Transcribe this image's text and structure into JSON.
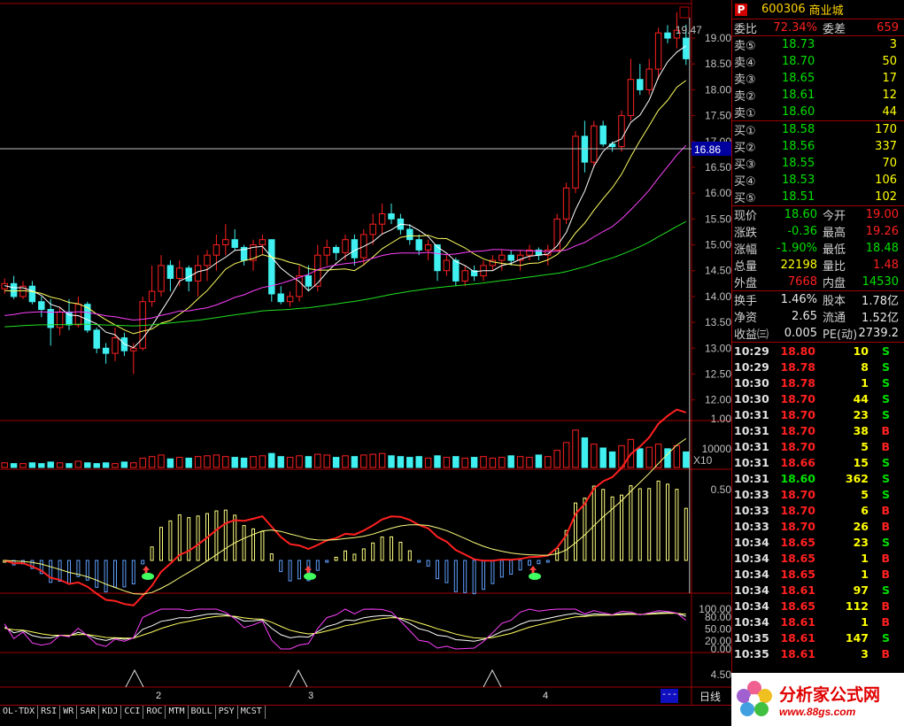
{
  "stock": {
    "badge": "P",
    "code": "600306",
    "name": "商业城"
  },
  "ratio": {
    "wei_bi_label": "委比",
    "wei_bi": "72.34%",
    "wei_cha_label": "委差",
    "wei_cha": "659"
  },
  "asks": [
    {
      "label": "卖⑤",
      "price": "18.73",
      "vol": "3"
    },
    {
      "label": "卖④",
      "price": "18.70",
      "vol": "50"
    },
    {
      "label": "卖③",
      "price": "18.65",
      "vol": "17"
    },
    {
      "label": "卖②",
      "price": "18.61",
      "vol": "12"
    },
    {
      "label": "卖①",
      "price": "18.60",
      "vol": "44"
    }
  ],
  "bids": [
    {
      "label": "买①",
      "price": "18.58",
      "vol": "170"
    },
    {
      "label": "买②",
      "price": "18.56",
      "vol": "337"
    },
    {
      "label": "买③",
      "price": "18.55",
      "vol": "70"
    },
    {
      "label": "买④",
      "price": "18.53",
      "vol": "106"
    },
    {
      "label": "买⑤",
      "price": "18.51",
      "vol": "102"
    }
  ],
  "quote": [
    {
      "l1": "现价",
      "v1": "18.60",
      "v1c": "green",
      "l2": "今开",
      "v2": "19.00",
      "v2c": "red"
    },
    {
      "l1": "涨跌",
      "v1": "-0.36",
      "v1c": "green",
      "l2": "最高",
      "v2": "19.26",
      "v2c": "red"
    },
    {
      "l1": "涨幅",
      "v1": "-1.90%",
      "v1c": "green",
      "l2": "最低",
      "v2": "18.48",
      "v2c": "green"
    },
    {
      "l1": "总量",
      "v1": "22198",
      "v1c": "yellow",
      "l2": "量比",
      "v2": "1.48",
      "v2c": "red"
    },
    {
      "l1": "外盘",
      "v1": "7668",
      "v1c": "red",
      "l2": "内盘",
      "v2": "14530",
      "v2c": "green"
    }
  ],
  "fund": [
    {
      "l1": "换手",
      "v1": "1.46%",
      "l2": "股本",
      "v2": "1.78亿"
    },
    {
      "l1": "净资",
      "v1": "2.65",
      "l2": "流通",
      "v2": "1.52亿"
    },
    {
      "l1": "收益㈢",
      "v1": "0.005",
      "l2": "PE(动)",
      "v2": "2739.2"
    }
  ],
  "ticks": [
    {
      "t": "10:29",
      "p": "18.80",
      "pc": "red",
      "v": "10",
      "d": "S",
      "dc": "green"
    },
    {
      "t": "10:29",
      "p": "18.78",
      "pc": "red",
      "v": "8",
      "d": "S",
      "dc": "green"
    },
    {
      "t": "10:30",
      "p": "18.78",
      "pc": "red",
      "v": "1",
      "d": "S",
      "dc": "green"
    },
    {
      "t": "10:30",
      "p": "18.70",
      "pc": "red",
      "v": "44",
      "d": "S",
      "dc": "green"
    },
    {
      "t": "10:31",
      "p": "18.70",
      "pc": "red",
      "v": "23",
      "d": "S",
      "dc": "green"
    },
    {
      "t": "10:31",
      "p": "18.70",
      "pc": "red",
      "v": "38",
      "d": "B",
      "dc": "red"
    },
    {
      "t": "10:31",
      "p": "18.70",
      "pc": "red",
      "v": "5",
      "d": "B",
      "dc": "red"
    },
    {
      "t": "10:31",
      "p": "18.66",
      "pc": "red",
      "v": "15",
      "d": "S",
      "dc": "green"
    },
    {
      "t": "10:31",
      "p": "18.60",
      "pc": "green",
      "v": "362",
      "d": "S",
      "dc": "green"
    },
    {
      "t": "10:33",
      "p": "18.70",
      "pc": "red",
      "v": "5",
      "d": "S",
      "dc": "green"
    },
    {
      "t": "10:33",
      "p": "18.70",
      "pc": "red",
      "v": "6",
      "d": "B",
      "dc": "red"
    },
    {
      "t": "10:33",
      "p": "18.70",
      "pc": "red",
      "v": "26",
      "d": "B",
      "dc": "red"
    },
    {
      "t": "10:34",
      "p": "18.65",
      "pc": "red",
      "v": "23",
      "d": "S",
      "dc": "green"
    },
    {
      "t": "10:34",
      "p": "18.65",
      "pc": "red",
      "v": "1",
      "d": "B",
      "dc": "red"
    },
    {
      "t": "10:34",
      "p": "18.65",
      "pc": "red",
      "v": "1",
      "d": "B",
      "dc": "red"
    },
    {
      "t": "10:34",
      "p": "18.61",
      "pc": "red",
      "v": "97",
      "d": "S",
      "dc": "green"
    },
    {
      "t": "10:34",
      "p": "18.65",
      "pc": "red",
      "v": "112",
      "d": "B",
      "dc": "red"
    },
    {
      "t": "10:34",
      "p": "18.61",
      "pc": "red",
      "v": "1",
      "d": "B",
      "dc": "red"
    },
    {
      "t": "10:35",
      "p": "18.61",
      "pc": "red",
      "v": "147",
      "d": "S",
      "dc": "green"
    },
    {
      "t": "10:35",
      "p": "18.61",
      "pc": "red",
      "v": "3",
      "d": "B",
      "dc": "red"
    }
  ],
  "tabs": [
    "OL-TDX",
    "RSI",
    "WR",
    "SAR",
    "KDJ",
    "CCI",
    "ROC",
    "MTM",
    "BOLL",
    "PSY",
    "MCST"
  ],
  "date_labels": [
    "2",
    "3",
    "4"
  ],
  "period": "日线",
  "dash_button": "---",
  "crosshair_price": "16.86",
  "peak_label": "19.47",
  "vol_axis": {
    "label": "10000",
    "unit": "X10"
  },
  "ind_axis": [
    "1.00",
    "0.50"
  ],
  "kdj_axis": [
    "100.00",
    "80.00",
    "50.00",
    "20.00",
    "0.00"
  ],
  "last_axis": "4.50",
  "price_axis": [
    "19.00",
    "18.50",
    "18.00",
    "17.50",
    "17.00",
    "16.50",
    "16.00",
    "15.50",
    "15.00",
    "14.50",
    "14.00",
    "13.50",
    "13.00",
    "12.50",
    "12.00"
  ],
  "watermark": {
    "brand": "分析家公式网",
    "url": "www.88gs.com"
  },
  "colors": {
    "up": "#ff2020",
    "down": "#40f0f0",
    "ma5": "#ffffff",
    "ma10": "#ffff60",
    "ma20": "#ff40ff",
    "ma60": "#20e020",
    "border": "#a00000"
  },
  "chart_data": {
    "type": "candlestick",
    "price_range": [
      11.6,
      19.6
    ],
    "candles": [
      [
        14.15,
        14.35,
        14.05,
        14.25
      ],
      [
        14.25,
        14.4,
        13.95,
        14.0
      ],
      [
        14.0,
        14.3,
        13.95,
        14.2
      ],
      [
        14.2,
        14.3,
        13.85,
        13.9
      ],
      [
        13.9,
        14.0,
        13.6,
        13.75
      ],
      [
        13.75,
        13.95,
        13.05,
        13.4
      ],
      [
        13.4,
        13.8,
        13.25,
        13.7
      ],
      [
        13.7,
        13.95,
        13.35,
        13.45
      ],
      [
        13.45,
        14.0,
        13.4,
        13.85
      ],
      [
        13.85,
        13.9,
        13.3,
        13.35
      ],
      [
        13.35,
        13.4,
        12.9,
        13.0
      ],
      [
        13.0,
        13.1,
        12.7,
        12.9
      ],
      [
        12.9,
        13.4,
        12.75,
        13.2
      ],
      [
        13.2,
        13.3,
        12.85,
        12.95
      ],
      [
        12.95,
        13.1,
        12.5,
        13.0
      ],
      [
        13.0,
        14.0,
        12.95,
        13.9
      ],
      [
        13.9,
        14.6,
        13.8,
        14.1
      ],
      [
        14.1,
        14.8,
        14.0,
        14.6
      ],
      [
        14.6,
        14.7,
        14.1,
        14.35
      ],
      [
        14.35,
        14.7,
        14.2,
        14.55
      ],
      [
        14.55,
        14.6,
        14.1,
        14.3
      ],
      [
        14.3,
        14.8,
        14.0,
        14.6
      ],
      [
        14.6,
        14.9,
        14.3,
        14.8
      ],
      [
        14.8,
        15.2,
        14.5,
        15.0
      ],
      [
        15.0,
        15.4,
        14.8,
        15.1
      ],
      [
        15.1,
        15.3,
        14.9,
        14.95
      ],
      [
        14.95,
        15.0,
        14.6,
        14.7
      ],
      [
        14.7,
        15.1,
        14.5,
        15.0
      ],
      [
        15.0,
        15.2,
        14.8,
        15.1
      ],
      [
        15.1,
        15.1,
        13.9,
        14.05
      ],
      [
        14.05,
        14.2,
        13.85,
        13.9
      ],
      [
        13.9,
        14.1,
        13.8,
        14.0
      ],
      [
        14.0,
        14.6,
        13.9,
        14.4
      ],
      [
        14.4,
        14.6,
        14.1,
        14.2
      ],
      [
        14.2,
        15.0,
        14.1,
        14.8
      ],
      [
        14.8,
        15.1,
        14.6,
        14.95
      ],
      [
        14.95,
        15.0,
        14.7,
        14.85
      ],
      [
        14.85,
        15.2,
        14.7,
        15.1
      ],
      [
        15.1,
        15.2,
        14.6,
        14.75
      ],
      [
        14.75,
        15.3,
        14.6,
        15.2
      ],
      [
        15.2,
        15.6,
        15.0,
        15.4
      ],
      [
        15.4,
        15.8,
        15.2,
        15.6
      ],
      [
        15.6,
        15.8,
        15.4,
        15.5
      ],
      [
        15.5,
        15.6,
        15.2,
        15.3
      ],
      [
        15.3,
        15.4,
        15.0,
        15.1
      ],
      [
        15.1,
        15.2,
        14.8,
        14.9
      ],
      [
        14.9,
        15.1,
        14.7,
        15.0
      ],
      [
        15.0,
        15.0,
        14.3,
        14.5
      ],
      [
        14.5,
        14.8,
        14.4,
        14.7
      ],
      [
        14.7,
        14.75,
        14.2,
        14.3
      ],
      [
        14.3,
        14.6,
        14.2,
        14.5
      ],
      [
        14.5,
        14.6,
        14.3,
        14.4
      ],
      [
        14.4,
        14.7,
        14.3,
        14.6
      ],
      [
        14.6,
        14.8,
        14.5,
        14.7
      ],
      [
        14.7,
        14.9,
        14.5,
        14.8
      ],
      [
        14.8,
        14.9,
        14.6,
        14.7
      ],
      [
        14.7,
        14.9,
        14.5,
        14.8
      ],
      [
        14.8,
        15.0,
        14.7,
        14.9
      ],
      [
        14.9,
        14.95,
        14.7,
        14.8
      ],
      [
        14.8,
        15.0,
        14.6,
        14.9
      ],
      [
        14.9,
        15.6,
        14.9,
        15.5
      ],
      [
        15.5,
        16.2,
        15.4,
        16.1
      ],
      [
        16.1,
        17.2,
        16.0,
        17.1
      ],
      [
        17.1,
        17.4,
        16.4,
        16.6
      ],
      [
        16.6,
        17.4,
        16.5,
        17.3
      ],
      [
        17.3,
        17.4,
        16.9,
        16.95
      ],
      [
        16.95,
        17.0,
        16.8,
        16.9
      ],
      [
        16.9,
        17.6,
        16.8,
        17.5
      ],
      [
        17.5,
        18.6,
        17.4,
        18.2
      ],
      [
        18.2,
        18.5,
        17.9,
        18.0
      ],
      [
        18.0,
        18.6,
        17.9,
        18.4
      ],
      [
        18.4,
        19.2,
        18.2,
        19.1
      ],
      [
        19.1,
        19.25,
        18.9,
        19.0
      ],
      [
        19.0,
        19.5,
        18.8,
        19.15
      ],
      [
        19.0,
        19.26,
        18.48,
        18.6
      ]
    ],
    "volumes": [
      6,
      5,
      5,
      6,
      5,
      7,
      6,
      5,
      8,
      6,
      5,
      6,
      5,
      7,
      6,
      12,
      14,
      16,
      11,
      13,
      12,
      14,
      15,
      16,
      14,
      13,
      12,
      14,
      15,
      18,
      14,
      13,
      15,
      14,
      17,
      16,
      13,
      15,
      14,
      16,
      17,
      18,
      15,
      14,
      13,
      14,
      12,
      15,
      13,
      14,
      12,
      13,
      14,
      12,
      13,
      15,
      14,
      13,
      16,
      14,
      22,
      32,
      48,
      38,
      30,
      25,
      20,
      28,
      36,
      24,
      26,
      30,
      24,
      28,
      20
    ]
  }
}
